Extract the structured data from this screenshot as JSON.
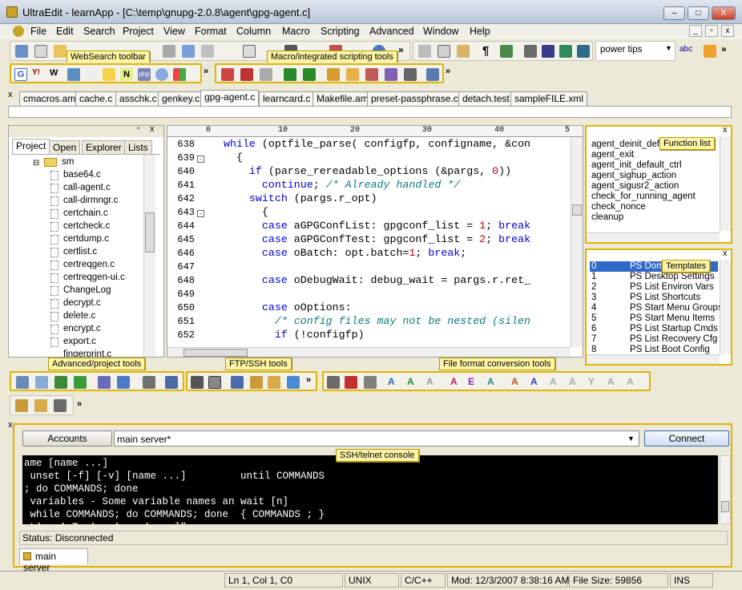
{
  "window": {
    "title": "UltraEdit - learnApp - [C:\\temp\\gnupg-2.0.8\\agent\\gpg-agent.c]",
    "min": "–",
    "max": "□",
    "close": "X"
  },
  "menu": [
    "File",
    "Edit",
    "Search",
    "Project",
    "View",
    "Format",
    "Column",
    "Macro",
    "Scripting",
    "Advanced",
    "Window",
    "Help"
  ],
  "toolbar": {
    "search_value": "power tips",
    "more": "»"
  },
  "callouts": {
    "websearch": "WebSearch toolbar",
    "macro": "Macro/integrated scripting tools",
    "function_list": "Function list",
    "templates": "Templates",
    "advanced": "Advanced/project tools",
    "ftp": "FTP/SSH tools",
    "fileformat": "File format conversion tools",
    "ssh": "SSH/telnet console"
  },
  "file_tabs": [
    "cmacros.am",
    "cache.c",
    "asschk.c",
    "genkey.c",
    "gpg-agent.c",
    "learncard.c",
    "Makefile.am",
    "preset-passphrase.c",
    "detach.test",
    "sampleFILE.xml"
  ],
  "project": {
    "tabs": [
      "Project",
      "Open",
      "Explorer",
      "Lists"
    ],
    "folder": "sm",
    "files": [
      "base64.c",
      "call-agent.c",
      "call-dirmngr.c",
      "certchain.c",
      "certcheck.c",
      "certdump.c",
      "certlist.c",
      "certreqgen.c",
      "certreqgen-ui.c",
      "ChangeLog",
      "decrypt.c",
      "delete.c",
      "encrypt.c",
      "export.c",
      "fingerprint.c"
    ]
  },
  "editor": {
    "ruler": [
      "0",
      "10",
      "20",
      "30",
      "40",
      "5"
    ],
    "lines": [
      {
        "n": "638",
        "fold": "",
        "code": "while (optfile_parse( configfp, configname, &con"
      },
      {
        "n": "639",
        "fold": "-",
        "code": "  {"
      },
      {
        "n": "640",
        "fold": "",
        "code": "    if (parse_rereadable_options (&pargs, 0))"
      },
      {
        "n": "641",
        "fold": "",
        "code": "      continue; /* Already handled */"
      },
      {
        "n": "642",
        "fold": "",
        "code": "    switch (pargs.r_opt)"
      },
      {
        "n": "643",
        "fold": "-",
        "code": "      {"
      },
      {
        "n": "644",
        "fold": "",
        "code": "      case aGPGConfList: gpgconf_list = 1; break"
      },
      {
        "n": "645",
        "fold": "",
        "code": "      case aGPGConfTest: gpgconf_list = 2; break"
      },
      {
        "n": "646",
        "fold": "",
        "code": "      case oBatch: opt.batch=1; break;"
      },
      {
        "n": "647",
        "fold": "",
        "code": ""
      },
      {
        "n": "648",
        "fold": "",
        "code": "      case oDebugWait: debug_wait = pargs.r.ret_"
      },
      {
        "n": "649",
        "fold": "",
        "code": ""
      },
      {
        "n": "650",
        "fold": "",
        "code": "      case oOptions:"
      },
      {
        "n": "651",
        "fold": "",
        "code": "        /* config files may not be nested (silen"
      },
      {
        "n": "652",
        "fold": "",
        "code": "        if (!configfp)"
      }
    ]
  },
  "function_list": [
    "agent_deinit_def",
    "agent_exit",
    "agent_init_default_ctrl",
    "agent_sighup_action",
    "agent_sigusr2_action",
    "check_for_running_agent",
    "check_nonce",
    "cleanup"
  ],
  "templates": [
    {
      "n": "0",
      "name": "PS Dom"
    },
    {
      "n": "1",
      "name": "PS Desktop Settings"
    },
    {
      "n": "2",
      "name": "PS List Environ Vars"
    },
    {
      "n": "3",
      "name": "PS List Shortcuts"
    },
    {
      "n": "4",
      "name": "PS Start Menu Groups"
    },
    {
      "n": "5",
      "name": "PS Start Menu Items"
    },
    {
      "n": "6",
      "name": "PS List Startup Cmds"
    },
    {
      "n": "7",
      "name": "PS List Recovery Cfg"
    },
    {
      "n": "8",
      "name": "PS List Boot Config"
    }
  ],
  "console": {
    "accounts": "Accounts",
    "server": "main server*",
    "connect": "Connect",
    "lines": [
      "ame [name ...]",
      " unset [-f] [-v] [name ...]         until COMMANDS",
      "; do COMMANDS; done",
      " variables - Some variable names an wait [n]",
      " while COMMANDS; do COMMANDS; done  { COMMANDS ; }",
      ".L^   ^.T  ^.  ^-   ^    ]\""
    ],
    "status": "Status: Disconnected",
    "tab": "main server"
  },
  "status": {
    "pos": "Ln 1, Col 1, C0",
    "eol": "UNIX",
    "lang": "C/C++",
    "mod": "Mod: 12/3/2007 8:38:16 AM",
    "size": "File Size: 59856",
    "mode": "INS"
  }
}
